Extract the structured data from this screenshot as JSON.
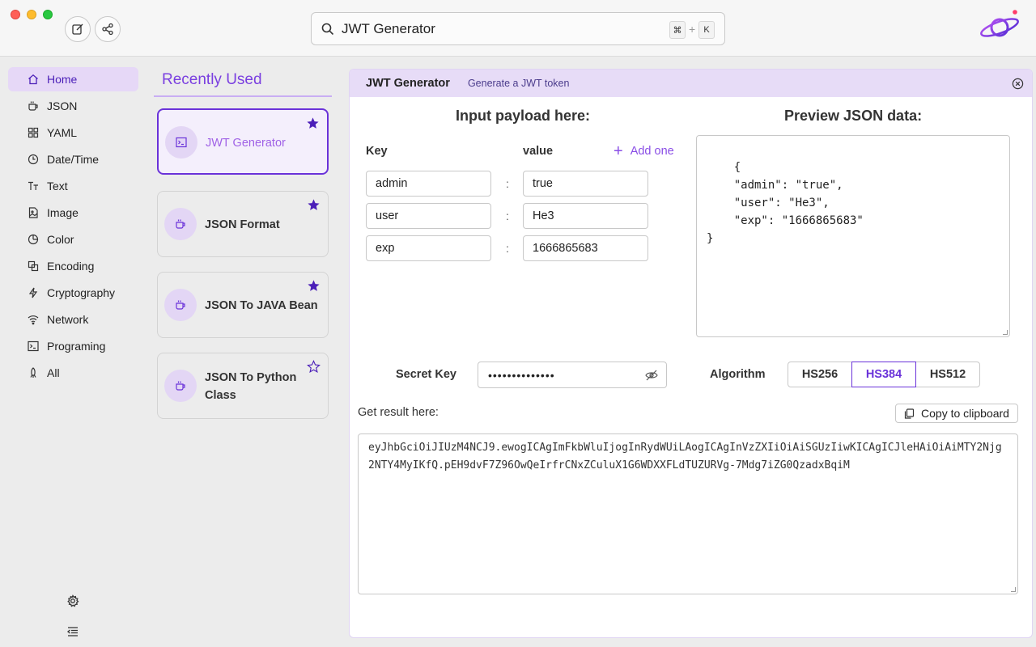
{
  "search": {
    "value": "JWT Generator",
    "shortcut_cmd": "⌘",
    "shortcut_plus": "+",
    "shortcut_key": "K"
  },
  "sidebar": {
    "items": [
      {
        "label": "Home",
        "icon": "home-icon",
        "active": true
      },
      {
        "label": "JSON",
        "icon": "cup-icon"
      },
      {
        "label": "YAML",
        "icon": "grid-icon"
      },
      {
        "label": "Date/Time",
        "icon": "clock-icon"
      },
      {
        "label": "Text",
        "icon": "text-icon"
      },
      {
        "label": "Image",
        "icon": "image-icon"
      },
      {
        "label": "Color",
        "icon": "pie-icon"
      },
      {
        "label": "Encoding",
        "icon": "encoding-icon"
      },
      {
        "label": "Cryptography",
        "icon": "bolt-icon"
      },
      {
        "label": "Network",
        "icon": "wifi-icon"
      },
      {
        "label": "Programing",
        "icon": "terminal-icon"
      },
      {
        "label": "All",
        "icon": "rocket-icon"
      }
    ]
  },
  "recent": {
    "title": "Recently Used",
    "cards": [
      {
        "label": "JWT Generator",
        "starred": true
      },
      {
        "label": "JSON Format",
        "starred": true
      },
      {
        "label": "JSON To JAVA Bean",
        "starred": true
      },
      {
        "label_line1": "JSON To Python",
        "label_line2": "Class",
        "starred": false
      }
    ]
  },
  "tool": {
    "title": "JWT Generator",
    "subtitle": "Generate a JWT token",
    "input_heading": "Input payload here:",
    "preview_heading": "Preview JSON data:",
    "key_label": "Key",
    "value_label": "value",
    "add_one": "Add one",
    "colon": ":",
    "rows": [
      {
        "key": "admin",
        "value": "true"
      },
      {
        "key": "user",
        "value": "He3"
      },
      {
        "key": "exp",
        "value": "1666865683"
      }
    ],
    "preview_json": "{\n    \"admin\": \"true\",\n    \"user\": \"He3\",\n    \"exp\": \"1666865683\"\n}",
    "secret_label": "Secret Key",
    "secret_mask": "••••••••••••••",
    "algorithm_label": "Algorithm",
    "algorithms": [
      "HS256",
      "HS384",
      "HS512"
    ],
    "selected_algorithm": "HS384",
    "result_label": "Get result here:",
    "copy_label": "Copy to clipboard",
    "result_token": "eyJhbGciOiJIUzM4NCJ9.ewogICAgImFkbWluIjogInRydWUiLAogICAgInVzZXIiOiAiSGUzIiwKICAgICJleHAiOiAiMTY2Njg2NTY4MyIKfQ.pEH9dvF7Z96OwQeIrfrCNxZCuluX1G6WDXXFLdTUZURVg-7Mdg7iZG0QzadxBqiM"
  },
  "colors": {
    "accent": "#6a32d9",
    "accent_light": "#e6d8f7",
    "star": "#4b1fb8"
  }
}
